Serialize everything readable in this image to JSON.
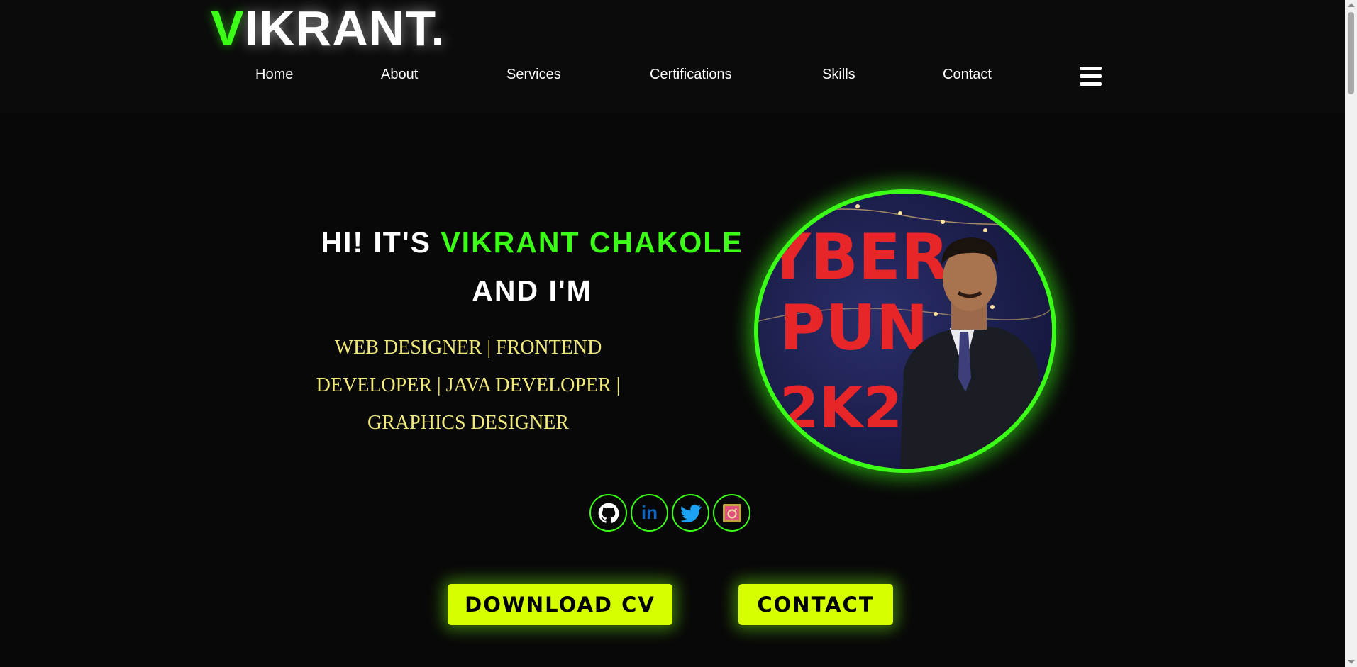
{
  "header": {
    "logo_accent": "V",
    "logo_rest": "IKRANT.",
    "nav": [
      {
        "label": "Home"
      },
      {
        "label": "About"
      },
      {
        "label": "Services"
      },
      {
        "label": "Certifications"
      },
      {
        "label": "Skills"
      },
      {
        "label": "Contact"
      }
    ],
    "menu_icon": "hamburger-icon"
  },
  "hero": {
    "greeting": "HI! IT'S",
    "name": "VIKRANT CHAKOLE",
    "line2": "AND I'M",
    "roles_line1": "WEB DESIGNER | FRONTEND",
    "roles_line2": "DEVELOPER | JAVA DEVELOPER |",
    "roles_line3": "GRAPHICS DESIGNER",
    "photo_sign_line1": "YBER",
    "photo_sign_line2": "PUN",
    "photo_sign_line3": "2K2"
  },
  "socials": [
    {
      "icon": "github-icon"
    },
    {
      "icon": "linkedin-icon",
      "text": "in"
    },
    {
      "icon": "twitter-icon"
    },
    {
      "icon": "instagram-icon"
    }
  ],
  "buttons": {
    "download_cv": "DOWNLOAD CV",
    "contact": "CONTACT"
  },
  "colors": {
    "accent_green": "#3bff16",
    "button_yellow": "#d6ff00",
    "roles_text": "#f0ea7a",
    "background": "#080808"
  }
}
